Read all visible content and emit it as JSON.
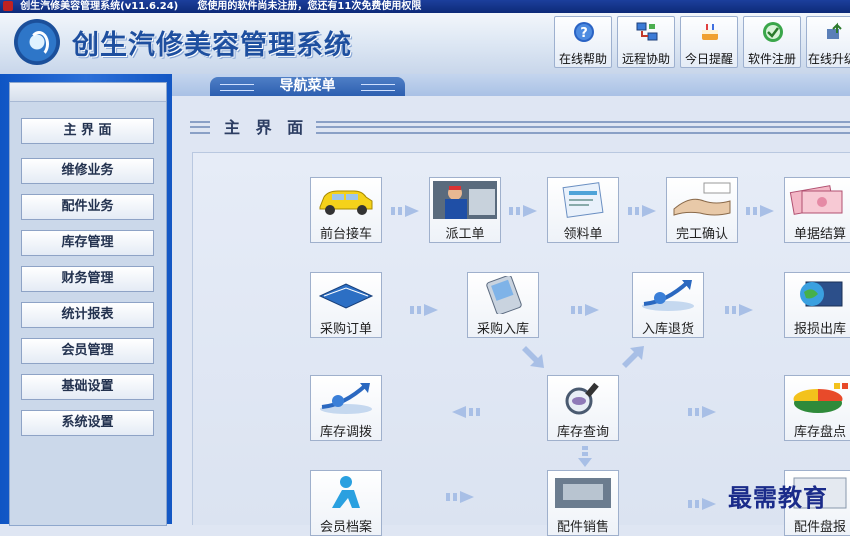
{
  "window": {
    "title": "创生汽修美容管理系统(v11.6.24)",
    "notice": "您使用的软件尚未注册，您还有11次免费使用权限"
  },
  "header": {
    "brand": "创生汽修美容管理系统",
    "toolbar": [
      {
        "label": "在线帮助",
        "icon": "help-icon"
      },
      {
        "label": "远程协助",
        "icon": "remote-assist-icon"
      },
      {
        "label": "今日提醒",
        "icon": "cake-icon"
      },
      {
        "label": "软件注册",
        "icon": "register-icon"
      },
      {
        "label": "在线升级",
        "icon": "upgrade-icon"
      }
    ]
  },
  "nav": {
    "tab_label": "导航菜单"
  },
  "sidebar": {
    "items": [
      {
        "label": "主 界 面"
      },
      {
        "label": "维修业务"
      },
      {
        "label": "配件业务"
      },
      {
        "label": "库存管理"
      },
      {
        "label": "财务管理"
      },
      {
        "label": "统计报表"
      },
      {
        "label": "会员管理"
      },
      {
        "label": "基础设置"
      },
      {
        "label": "系统设置"
      }
    ]
  },
  "main": {
    "title": "主 界 面",
    "functions": [
      {
        "label": "前台接车",
        "icon": "car-icon"
      },
      {
        "label": "派工单",
        "icon": "mechanic-icon"
      },
      {
        "label": "领料单",
        "icon": "parts-list-icon"
      },
      {
        "label": "完工确认",
        "icon": "handshake-icon"
      },
      {
        "label": "单据结算",
        "icon": "cash-icon"
      },
      {
        "label": "采购订单",
        "icon": "order-book-icon"
      },
      {
        "label": "采购入库",
        "icon": "pda-icon"
      },
      {
        "label": "入库退货",
        "icon": "return-chart-icon"
      },
      {
        "label": "报损出库",
        "icon": "globe-monitor-icon"
      },
      {
        "label": "库存调拨",
        "icon": "transfer-chart-icon"
      },
      {
        "label": "库存查询",
        "icon": "magnifier-icon"
      },
      {
        "label": "库存盘点",
        "icon": "pie-chart-icon"
      },
      {
        "label": "会员档案",
        "icon": "member-icon"
      },
      {
        "label": "配件销售",
        "icon": "parts-sale-icon"
      },
      {
        "label": "配件盘报",
        "icon": "parts-report-icon"
      }
    ]
  },
  "watermark": "最需教育",
  "colors": {
    "sidebar_blue": "#1a5fcf",
    "brand_blue": "#1e4f9f",
    "arrow_blue": "#a8bfe6"
  }
}
